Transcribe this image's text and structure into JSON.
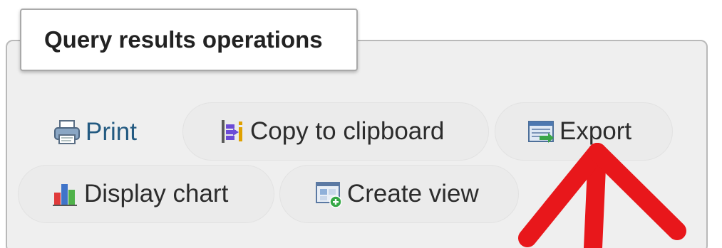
{
  "fieldset": {
    "legend": "Query results operations"
  },
  "operations": {
    "print": {
      "label": "Print",
      "icon": "printer-icon"
    },
    "copy": {
      "label": "Copy to clipboard",
      "icon": "clipboard-icon"
    },
    "export": {
      "label": "Export",
      "icon": "export-icon"
    },
    "chart": {
      "label": "Display chart",
      "icon": "bar-chart-icon"
    },
    "view": {
      "label": "Create view",
      "icon": "create-view-icon"
    }
  },
  "colors": {
    "link": "#235a81",
    "panel_bg": "#efefef",
    "annotation": "#e8171b"
  }
}
